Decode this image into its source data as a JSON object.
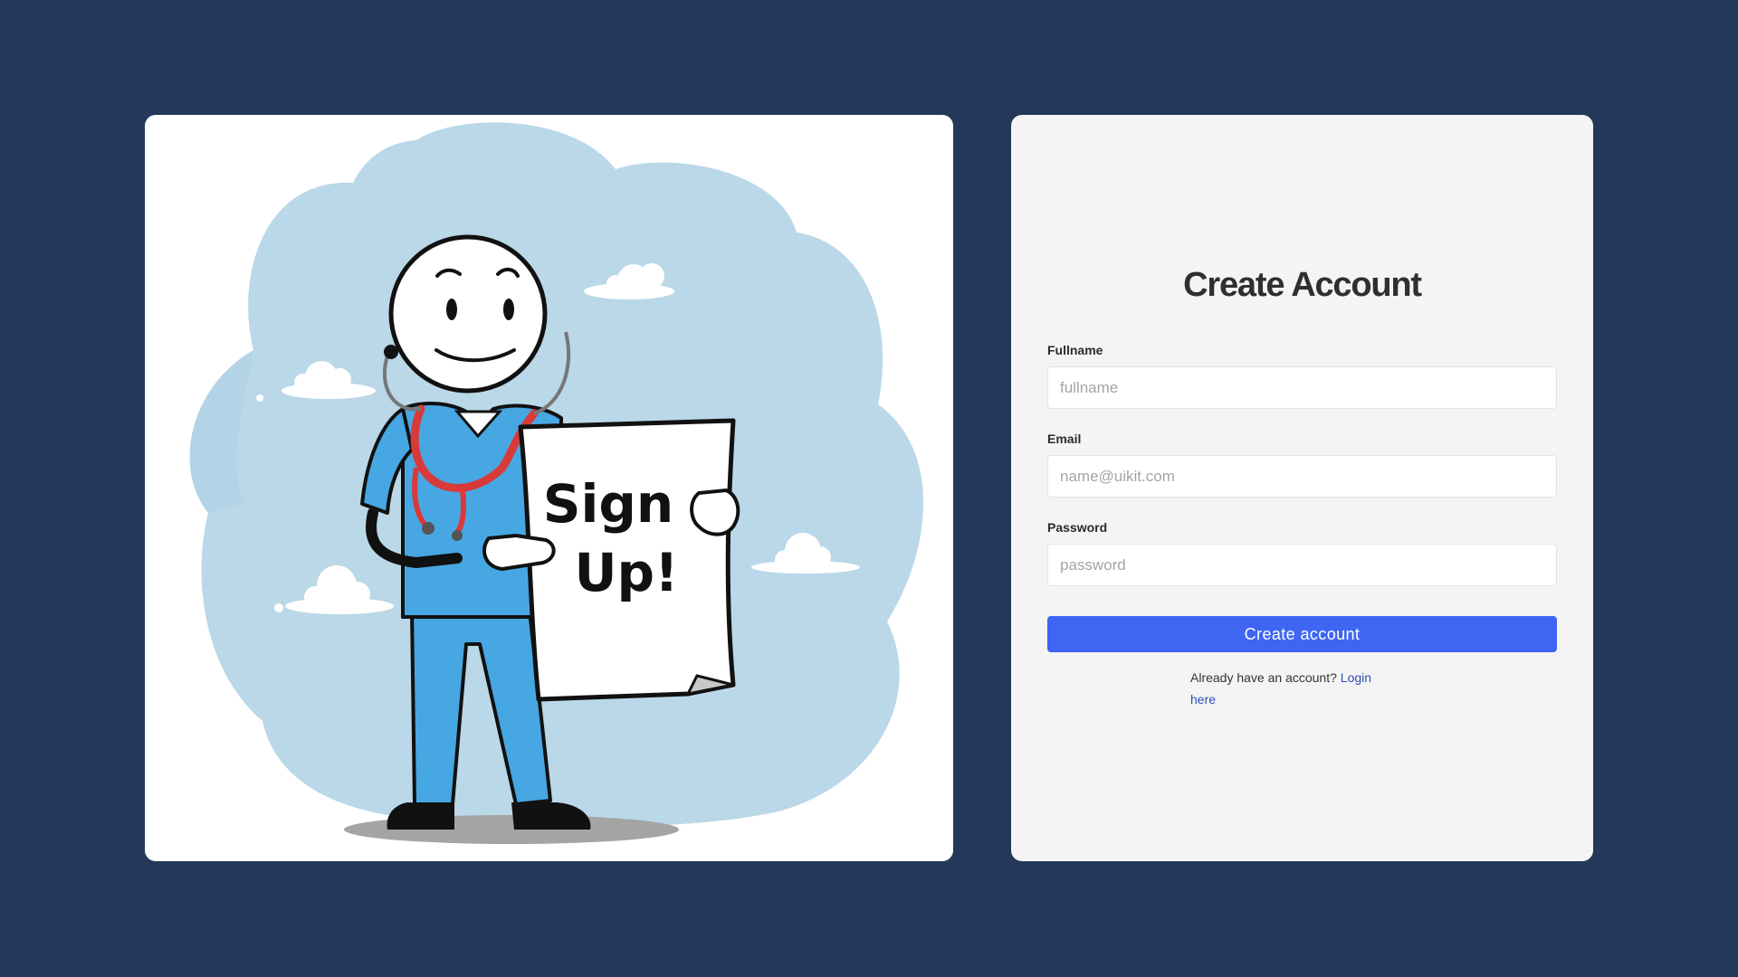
{
  "illustration": {
    "sign_line_1": "Sign",
    "sign_line_2": "Up!"
  },
  "form": {
    "title": "Create Account",
    "fields": [
      {
        "label": "Fullname",
        "placeholder": "fullname",
        "value": ""
      },
      {
        "label": "Email",
        "placeholder": "name@uikit.com",
        "value": ""
      },
      {
        "label": "Password",
        "placeholder": "password",
        "value": ""
      }
    ],
    "submit_label": "Create account",
    "login_prompt": "Already have an account?",
    "login_link": "Login here"
  },
  "colors": {
    "page_background": "#243859",
    "card_background": "#f4f4f4",
    "accent": "#3e66f2",
    "link": "#2f4fb3",
    "scrubs": "#47a7e3",
    "stethoscope": "#d83a3a",
    "sky_blob": "#bad8e8"
  }
}
